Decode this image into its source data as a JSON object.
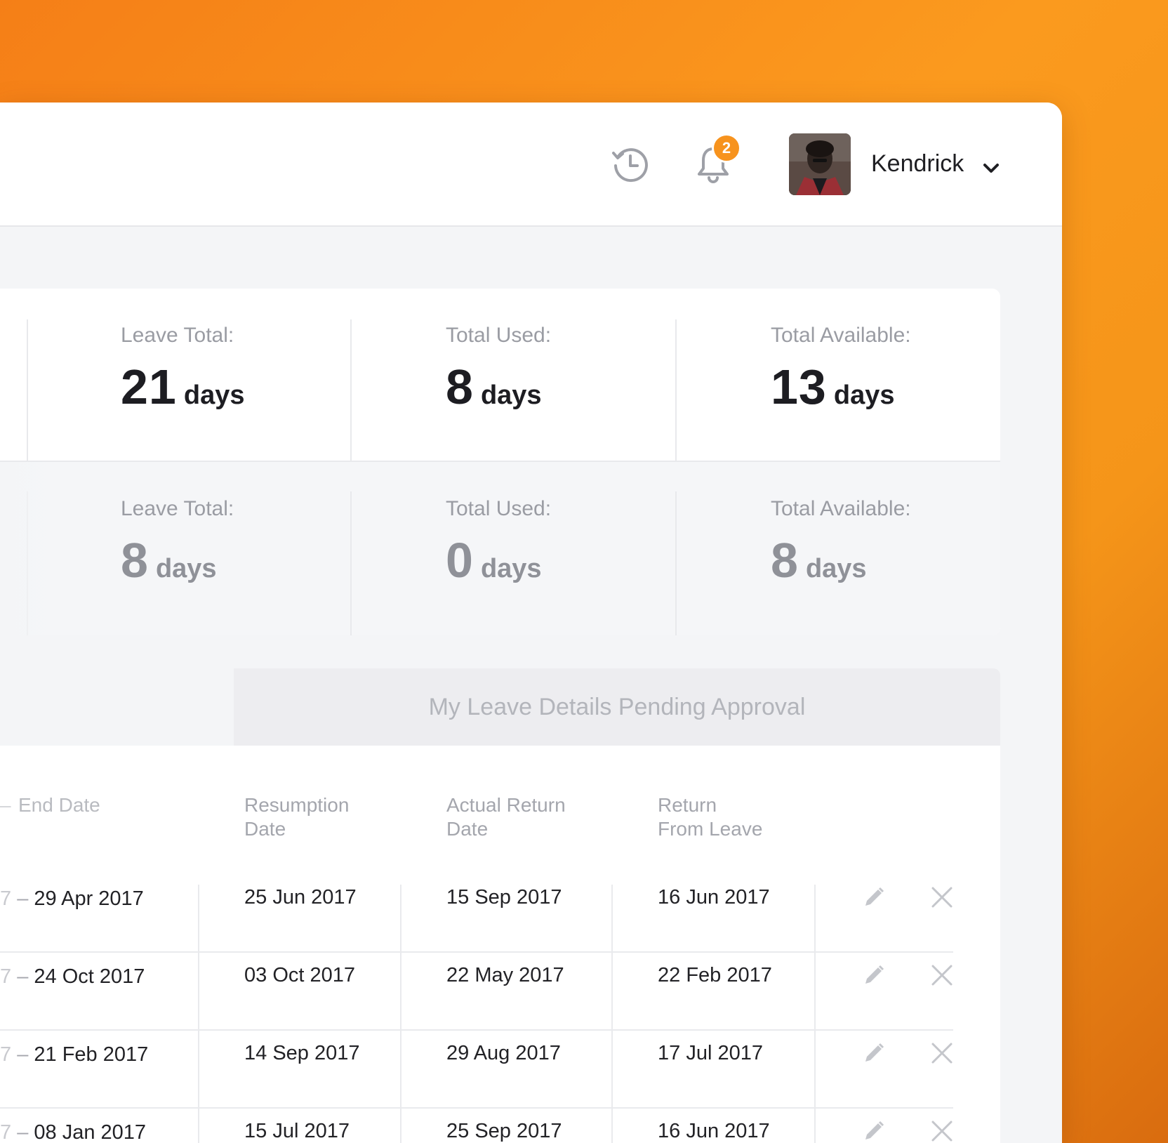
{
  "topbar": {
    "notification_count": "2",
    "user_name": "Kendrick"
  },
  "stats": [
    [
      {
        "label": "Leave Total:",
        "value": "21",
        "unit": "days"
      },
      {
        "label": "Total Used:",
        "value": "8",
        "unit": "days"
      },
      {
        "label": "Total Available:",
        "value": "13",
        "unit": "days"
      }
    ],
    [
      {
        "label": "Leave Total:",
        "value": "8",
        "unit": "days"
      },
      {
        "label": "Total Used:",
        "value": "0",
        "unit": "days"
      },
      {
        "label": "Total Available:",
        "value": "8",
        "unit": "days"
      }
    ]
  ],
  "tabs": {
    "pending_label": "My Leave Details Pending Approval"
  },
  "table": {
    "headers": {
      "end_prefix": "–",
      "end_date": "End Date",
      "resumption_line1": "Resumption",
      "resumption_line2": "Date",
      "actual_line1": "Actual Return",
      "actual_line2": "Date",
      "return_line1": "Return",
      "return_line2": "From Leave"
    },
    "rows": [
      {
        "start_tail": "7",
        "end": "29 Apr 2017",
        "resumption": "25 Jun 2017",
        "actual": "15 Sep 2017",
        "returned": "16 Jun 2017"
      },
      {
        "start_tail": "7",
        "end": "24 Oct 2017",
        "resumption": "03 Oct 2017",
        "actual": "22 May 2017",
        "returned": "22 Feb 2017"
      },
      {
        "start_tail": "7",
        "end": "21 Feb 2017",
        "resumption": "14 Sep 2017",
        "actual": "29 Aug 2017",
        "returned": "17 Jul 2017"
      },
      {
        "start_tail": "7",
        "end": "08 Jan 2017",
        "resumption": "15 Jul 2017",
        "actual": "25 Sep 2017",
        "returned": "16 Jun 2017"
      }
    ]
  },
  "colors": {
    "accent": "#f7931e",
    "background_orange": "#fb9a1e"
  },
  "icons": [
    "history-icon",
    "bell-icon",
    "chevron-down-icon",
    "pencil-icon",
    "close-icon"
  ]
}
